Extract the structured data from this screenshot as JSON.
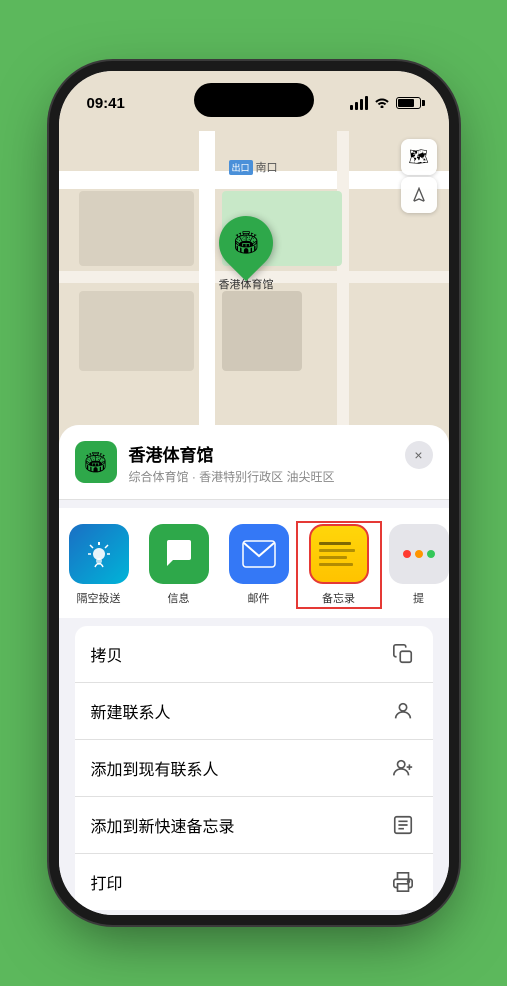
{
  "statusBar": {
    "time": "09:41",
    "locationArrow": "▶"
  },
  "map": {
    "areaLabel": "南口",
    "pinLabel": "香港体育馆",
    "pinEmoji": "🏟"
  },
  "mapControls": {
    "layerIcon": "🗺",
    "locationIcon": "➤"
  },
  "venueCard": {
    "name": "香港体育馆",
    "description": "综合体育馆 · 香港特别行政区 油尖旺区",
    "closeLabel": "×"
  },
  "shareItems": [
    {
      "id": "airdrop",
      "label": "隔空投送",
      "type": "airdrop"
    },
    {
      "id": "messages",
      "label": "信息",
      "type": "messages"
    },
    {
      "id": "mail",
      "label": "邮件",
      "type": "mail"
    },
    {
      "id": "notes",
      "label": "备忘录",
      "type": "notes",
      "highlighted": true
    },
    {
      "id": "more",
      "label": "提",
      "type": "more"
    }
  ],
  "actionItems": [
    {
      "id": "copy",
      "label": "拷贝",
      "icon": "copy"
    },
    {
      "id": "new-contact",
      "label": "新建联系人",
      "icon": "person"
    },
    {
      "id": "add-existing",
      "label": "添加到现有联系人",
      "icon": "person-add"
    },
    {
      "id": "add-notes",
      "label": "添加到新快速备忘录",
      "icon": "note"
    },
    {
      "id": "print",
      "label": "打印",
      "icon": "print"
    }
  ]
}
